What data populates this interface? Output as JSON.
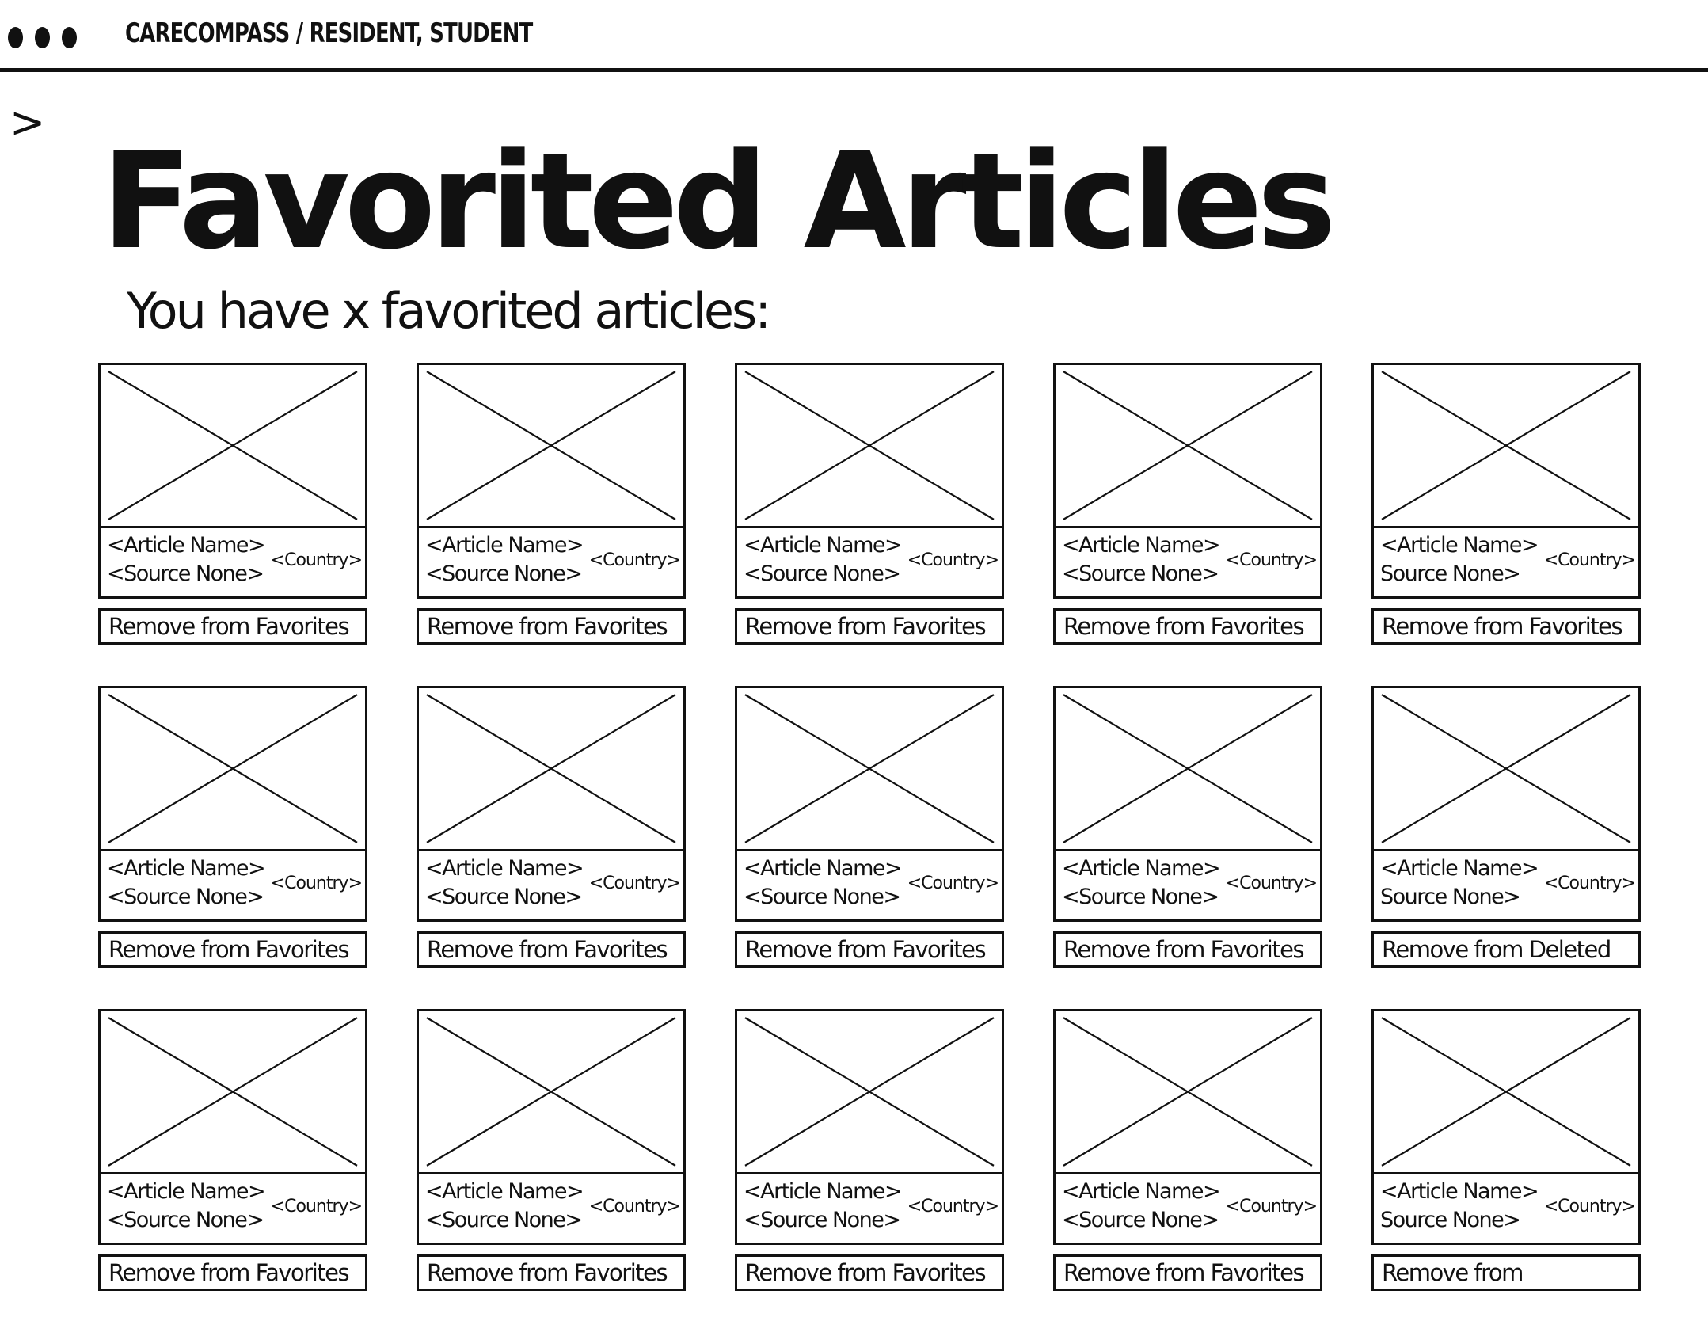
{
  "header": {
    "breadcrumb": "CARECOMPASS / RESIDENT, STUDENT"
  },
  "nav": {
    "toggle_glyph": ">"
  },
  "main": {
    "title": "Favorited Articles",
    "subtitle": "You have x favorited articles:"
  },
  "cards": [
    {
      "article_name": "<Article Name>",
      "source_name": "<Source None>",
      "country": "<Country>",
      "button_label": "Remove from Favorites"
    },
    {
      "article_name": "<Article Name>",
      "source_name": "<Source None>",
      "country": "<Country>",
      "button_label": "Remove from Favorites"
    },
    {
      "article_name": "<Article Name>",
      "source_name": "<Source None>",
      "country": "<Country>",
      "button_label": "Remove from Favorites"
    },
    {
      "article_name": "<Article Name>",
      "source_name": "<Source None>",
      "country": "<Country>",
      "button_label": "Remove from Favorites"
    },
    {
      "article_name": "<Article Name>",
      "source_name": "Source None>",
      "country": "<Country>",
      "button_label": "Remove from Favorites"
    },
    {
      "article_name": "<Article Name>",
      "source_name": "<Source None>",
      "country": "<Country>",
      "button_label": "Remove from Favorites"
    },
    {
      "article_name": "<Article Name>",
      "source_name": "<Source None>",
      "country": "<Country>",
      "button_label": "Remove from Favorites"
    },
    {
      "article_name": "<Article Name>",
      "source_name": "<Source None>",
      "country": "<Country>",
      "button_label": "Remove from Favorites"
    },
    {
      "article_name": "<Article Name>",
      "source_name": "<Source None>",
      "country": "<Country>",
      "button_label": "Remove from Favorites"
    },
    {
      "article_name": "<Article Name>",
      "source_name": "Source None>",
      "country": "<Country>",
      "button_label": "Remove from Deleted"
    },
    {
      "article_name": "<Article Name>",
      "source_name": "<Source None>",
      "country": "<Country>",
      "button_label": "Remove from Favorites"
    },
    {
      "article_name": "<Article Name>",
      "source_name": "<Source None>",
      "country": "<Country>",
      "button_label": "Remove from Favorites"
    },
    {
      "article_name": "<Article Name>",
      "source_name": "<Source None>",
      "country": "<Country>",
      "button_label": "Remove from Favorites"
    },
    {
      "article_name": "<Article Name>",
      "source_name": "<Source None>",
      "country": "<Country>",
      "button_label": "Remove from Favorites"
    },
    {
      "article_name": "<Article Name>",
      "source_name": "Source None>",
      "country": "<Country>",
      "button_label": "Remove from"
    }
  ]
}
